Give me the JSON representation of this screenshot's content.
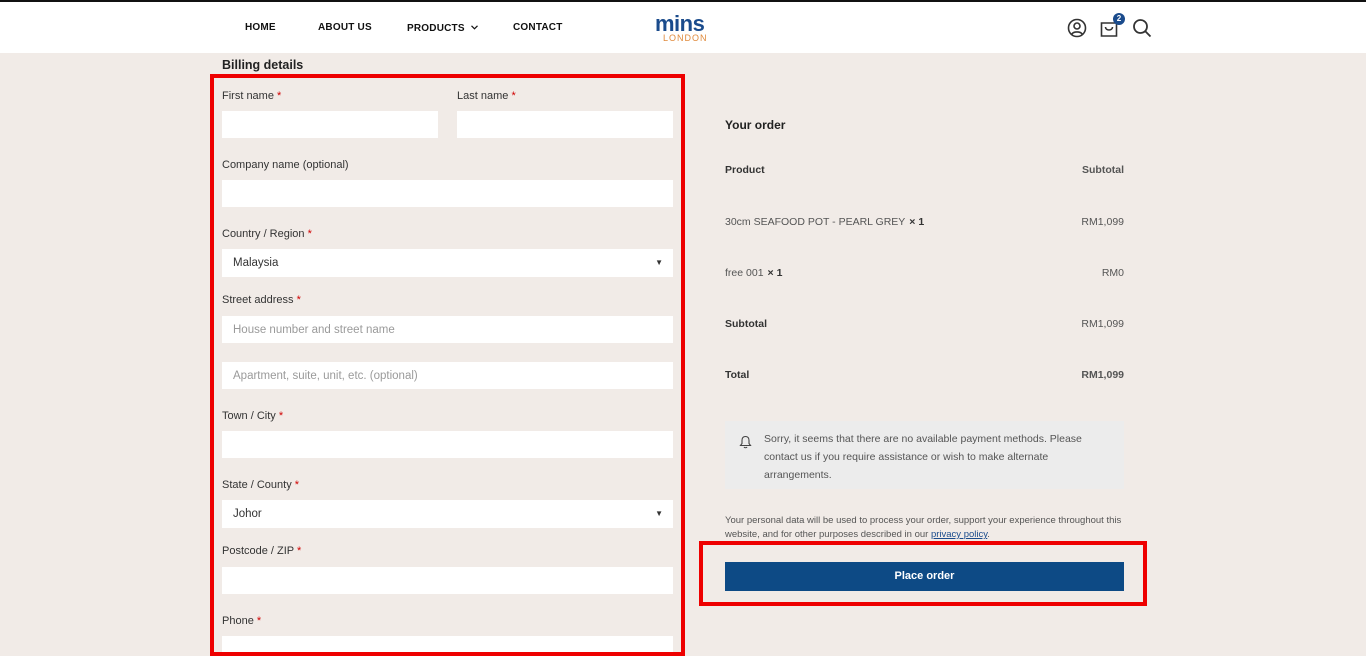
{
  "nav": {
    "home": "HOME",
    "about": "ABOUT US",
    "products": "PRODUCTS",
    "contact": "CONTACT"
  },
  "logo": {
    "main": "mins",
    "sub": "LONDON"
  },
  "cart": {
    "count": "2"
  },
  "icons": [
    "user-icon",
    "cart-icon",
    "search-icon",
    "chevron-down-icon",
    "bell-icon"
  ],
  "billing": {
    "title": "Billing details",
    "first_name_label": "First name",
    "last_name_label": "Last name",
    "company_label": "Company name (optional)",
    "country_label": "Country / Region",
    "country_value": "Malaysia",
    "street_label": "Street address",
    "street_placeholder": "House number and street name",
    "apartment_placeholder": "Apartment, suite, unit, etc. (optional)",
    "town_label": "Town / City",
    "state_label": "State / County",
    "state_value": "Johor",
    "postcode_label": "Postcode / ZIP",
    "phone_label": "Phone",
    "required_mark": "*"
  },
  "order": {
    "title": "Your order",
    "col_product": "Product",
    "col_subtotal": "Subtotal",
    "items": [
      {
        "name": "30cm SEAFOOD POT - PEARL GREY",
        "qty": "× 1",
        "price": "RM1,099"
      },
      {
        "name": "free 001",
        "qty": "× 1",
        "price": "RM0"
      }
    ],
    "subtotal_label": "Subtotal",
    "subtotal_value": "RM1,099",
    "total_label": "Total",
    "total_value": "RM1,099",
    "notice": "Sorry, it seems that there are no available payment methods. Please contact us if you require assistance or wish to make alternate arrangements.",
    "privacy_text": "Your personal data will be used to process your order, support your experience throughout this website, and for other purposes described in our",
    "privacy_link": "privacy policy",
    "privacy_end": ".",
    "place_order": "Place order"
  },
  "colors": {
    "accent": "#0d4a85",
    "highlight": "#ee0000",
    "background": "#f1ebe7",
    "required": "#d00000"
  }
}
